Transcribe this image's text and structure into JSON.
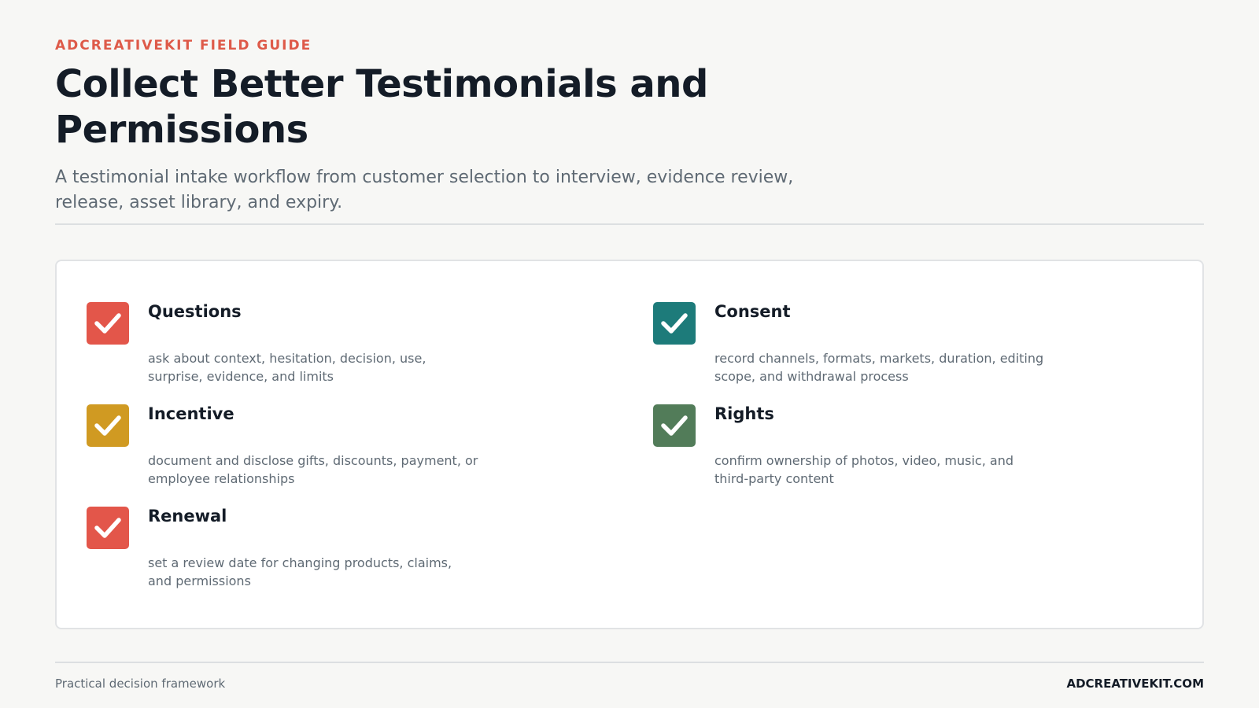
{
  "header": {
    "eyebrow": "ADCREATIVEKIT FIELD GUIDE",
    "title": "Collect Better Testimonials and Permissions",
    "subtitle": "A testimonial intake workflow from customer selection to interview, evidence review, release, asset library, and expiry."
  },
  "checklist": [
    {
      "title": "Questions",
      "description": "ask about context, hesitation, decision, use, surprise, evidence, and limits",
      "color": "#e3564a",
      "icon": "check-icon"
    },
    {
      "title": "Consent",
      "description": "record channels, formats, markets, duration, editing scope, and withdrawal process",
      "color": "#1d7b7a",
      "icon": "check-icon"
    },
    {
      "title": "Incentive",
      "description": "document and disclose gifts, discounts, payment, or employee relationships",
      "color": "#d09a22",
      "icon": "check-icon"
    },
    {
      "title": "Rights",
      "description": "confirm ownership of photos, video, music, and third-party content",
      "color": "#527c59",
      "icon": "check-icon"
    },
    {
      "title": "Renewal",
      "description": "set a review date for changing products, claims, and permissions",
      "color": "#e3564a",
      "icon": "check-icon"
    }
  ],
  "footer": {
    "left": "Practical decision framework",
    "right": "ADCREATIVEKIT.COM"
  }
}
